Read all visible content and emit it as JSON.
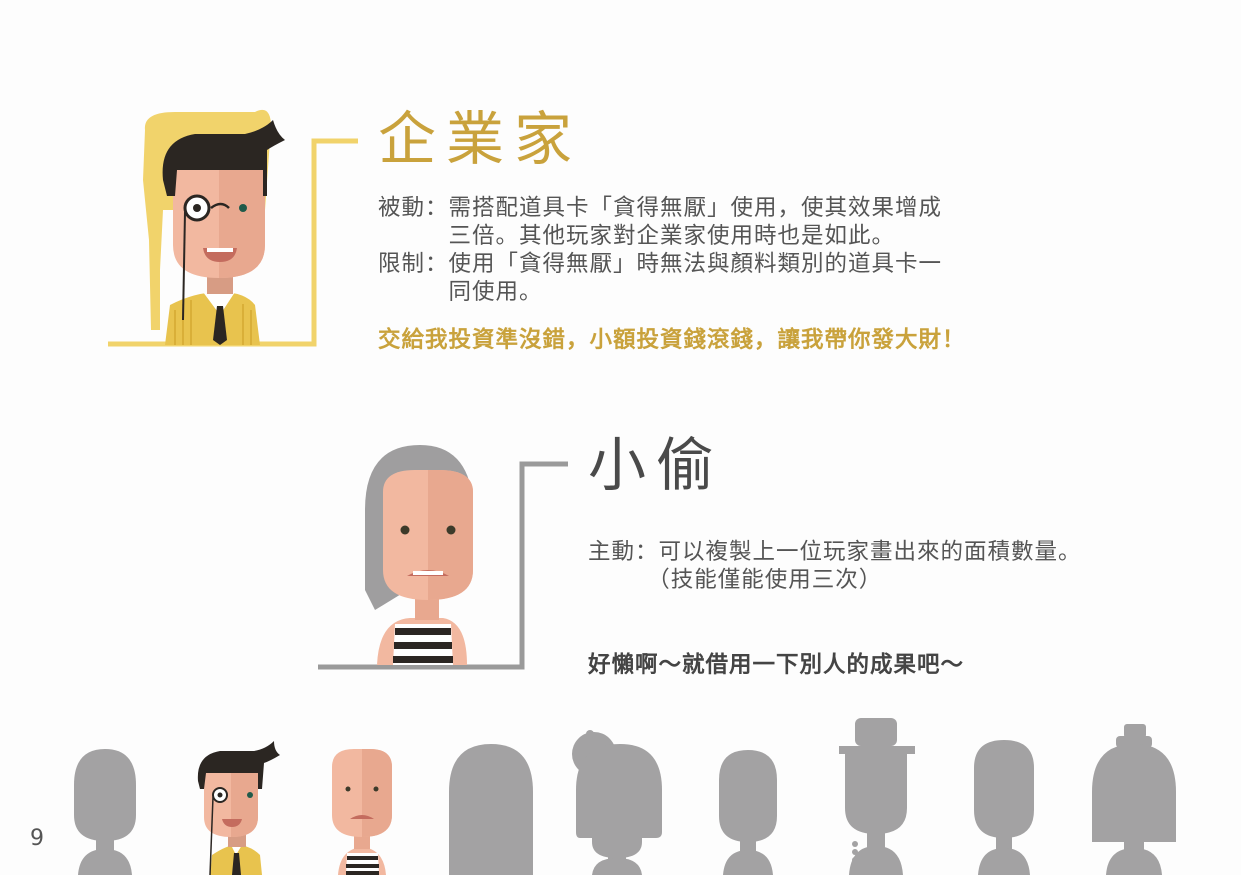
{
  "page_number": "9",
  "colors": {
    "gold": "#c9a23c",
    "frame_yellow": "#f1d36b",
    "frame_gray": "#9a9a9a",
    "silhouette": "#a3a2a3"
  },
  "sections": [
    {
      "title": "企業家",
      "lines": [
        "被動：需搭配道具卡「貪得無厭」使用，使其效果增成",
        "　　　三倍。其他玩家對企業家使用時也是如此。",
        "限制：使用「貪得無厭」時無法與顏料類別的道具卡一",
        "　　　同使用。"
      ],
      "quote": "交給我投資準沒錯，小額投資錢滾錢，讓我帶你發大財！"
    },
    {
      "title": "小偷",
      "lines": [
        "主動：可以複製上一位玩家畫出來的面積數量。",
        "　　　（技能僅能使用三次）"
      ],
      "quote": "好懶啊～就借用一下別人的成果吧～"
    }
  ],
  "character_row": [
    "silhouette-1-icon",
    "entrepreneur-small-icon",
    "thief-small-icon",
    "silhouette-4-icon",
    "silhouette-5-icon",
    "silhouette-6-icon",
    "silhouette-7-icon",
    "silhouette-8-icon",
    "silhouette-9-icon"
  ]
}
